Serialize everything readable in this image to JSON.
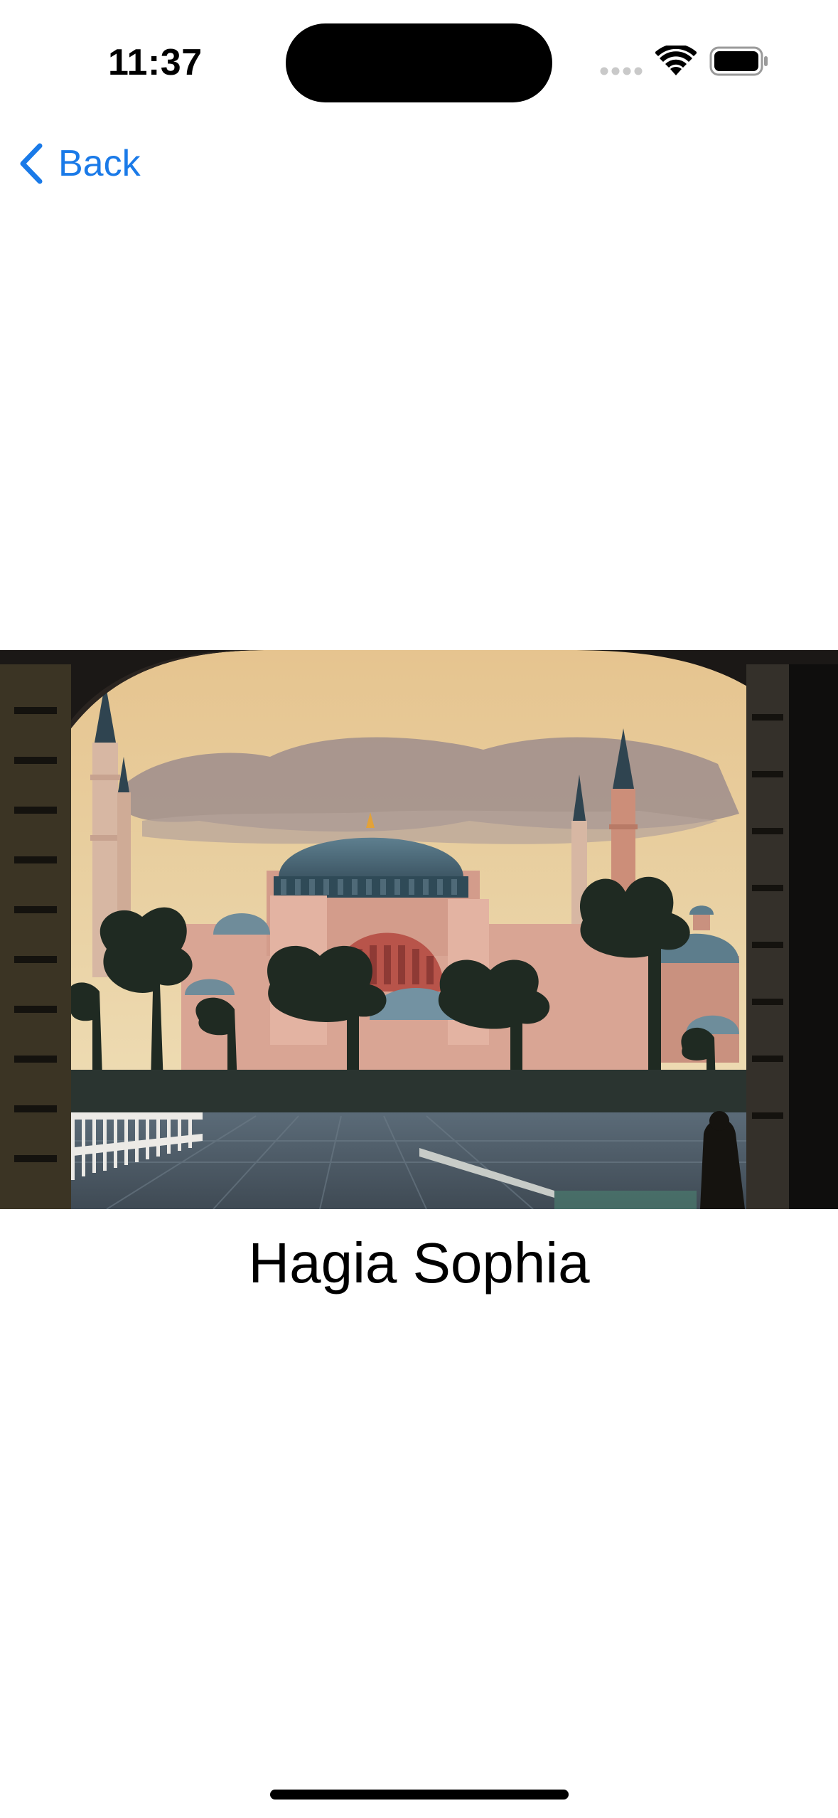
{
  "status_bar": {
    "time": "11:37",
    "icons": [
      "cellular-signal-icon",
      "wifi-icon",
      "battery-icon"
    ]
  },
  "nav": {
    "back_label": "Back",
    "back_icon": "chevron-left-icon",
    "accent_color": "#1a7ae8"
  },
  "hero_image": {
    "subject": "photo-hagia-sophia"
  },
  "place": {
    "title": "Hagia Sophia"
  }
}
